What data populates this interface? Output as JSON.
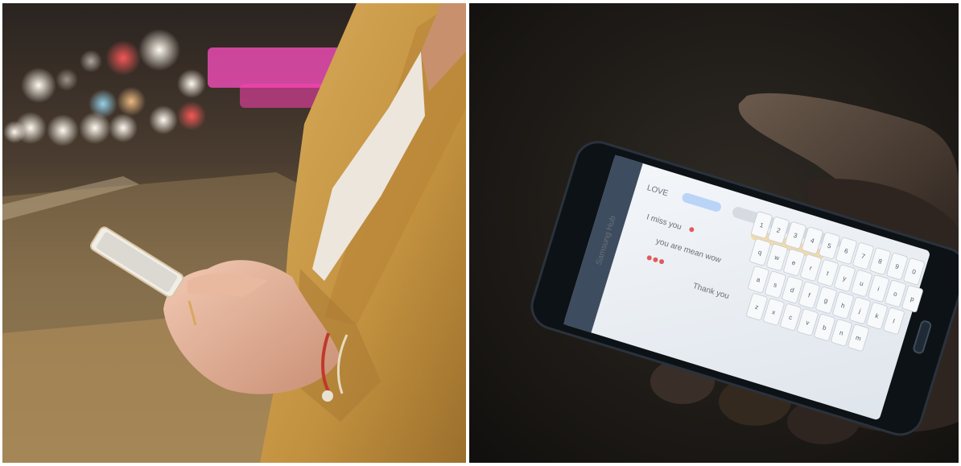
{
  "photos": [
    {
      "subject": "woman in mustard blazer texting on smartphone at night city street",
      "bokeh_colors": [
        "#f7f1e6",
        "#ff5a5a",
        "#ff5fc8",
        "#7fd8ff",
        "#ffd9a0"
      ]
    },
    {
      "subject": "hand holding glowing smartphone with messaging app in the dark",
      "screen": {
        "header": "Samsung Hub",
        "contact": "LOVE",
        "messages": [
          "I miss you",
          "you are mean wow",
          "Thank you"
        ],
        "keyboard_rows": [
          [
            "1",
            "2",
            "3",
            "4",
            "5",
            "6",
            "7",
            "8",
            "9",
            "0"
          ],
          [
            "q",
            "w",
            "e",
            "r",
            "t",
            "y",
            "u",
            "i",
            "o",
            "p"
          ],
          [
            "a",
            "s",
            "d",
            "f",
            "g",
            "h",
            "j",
            "k",
            "l"
          ],
          [
            "z",
            "x",
            "c",
            "v",
            "b",
            "n",
            "m"
          ]
        ]
      }
    }
  ],
  "colors": {
    "left_bg": "#6e5a3a",
    "blazer": "#c99a45",
    "right_bg": "#1a1714",
    "screen": "#e9edf2"
  }
}
